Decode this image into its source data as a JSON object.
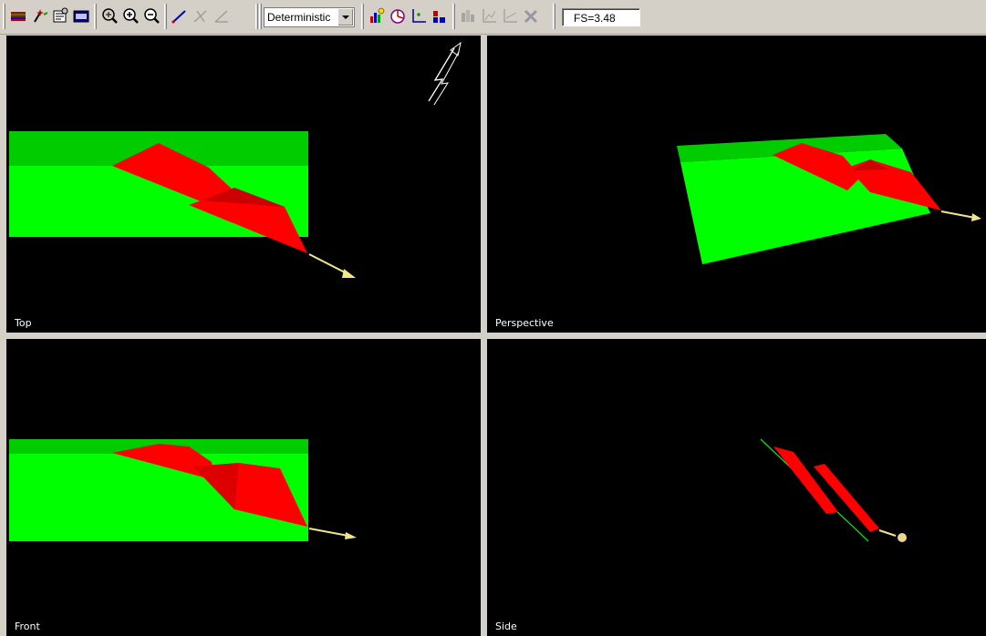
{
  "toolbar": {
    "analysis_mode": "Deterministic",
    "factor_of_safety": "FS=3.48",
    "icons": [
      "layers-icon",
      "wand-icon",
      "properties-icon",
      "info-viewer-icon",
      "zoom-extents-icon",
      "zoom-in-icon",
      "zoom-out-icon",
      "draw-line-icon",
      "transform-icon",
      "angle-icon",
      "graph-icon",
      "sensitivity-icon",
      "scatter-plot-icon",
      "histogram-icon",
      "chart-icon",
      "stats-icon",
      "plot-icon",
      "delete-series-icon"
    ]
  },
  "viewports": {
    "top": {
      "label": "Top"
    },
    "perspective": {
      "label": "Perspective"
    },
    "front": {
      "label": "Front"
    },
    "side": {
      "label": "Side"
    }
  },
  "colors": {
    "slope_light": "#00ff00",
    "slope_dark": "#00cc00",
    "wedge": "#ff0000",
    "wedge_dark": "#cc0000",
    "force_arrow": "#f0e68c",
    "background": "#000000"
  }
}
